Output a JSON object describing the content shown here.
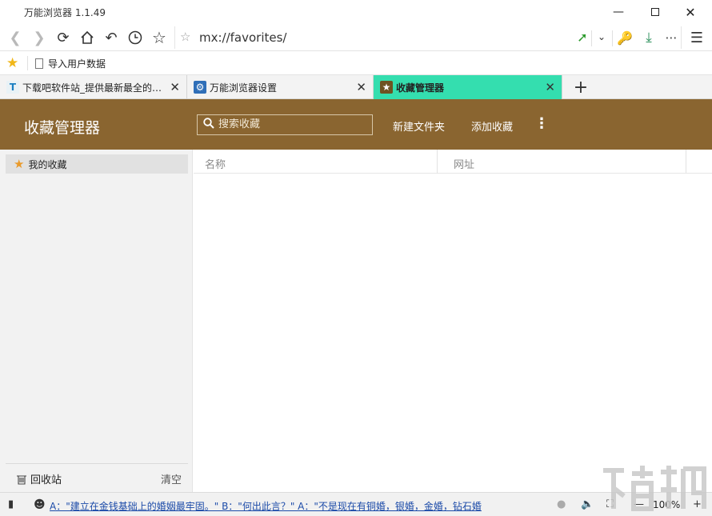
{
  "window": {
    "title": "万能浏览器 1.1.49",
    "minimize_icon": "minimize-icon",
    "maximize_icon": "maximize-icon",
    "close_icon": "close-icon"
  },
  "toolbar": {
    "address": "mx://favorites/",
    "icons": [
      "back-icon",
      "forward-icon",
      "refresh-icon",
      "home-icon",
      "undo-icon",
      "history-icon",
      "bookmark-star-icon",
      "address-star-icon",
      "pin-icon",
      "chevron-down-icon",
      "key-icon",
      "download-icon",
      "more-icon",
      "menu-icon"
    ]
  },
  "bookmarks_bar": {
    "item_label": "导入用户数据"
  },
  "tabs": [
    {
      "label": "下载吧软件站_提供最新最全的…",
      "icon": "tab-site-icon",
      "active": false
    },
    {
      "label": "万能浏览器设置",
      "icon": "settings-gear-icon",
      "active": false
    },
    {
      "label": "收藏管理器",
      "icon": "favorites-star-icon",
      "active": true
    }
  ],
  "header": {
    "title": "收藏管理器",
    "search_placeholder": "搜索收藏",
    "new_folder": "新建文件夹",
    "add_favorite": "添加收藏",
    "more": "⋮"
  },
  "sidebar": {
    "items": [
      {
        "label": "我的收藏",
        "icon": "star-icon"
      }
    ],
    "trash_label": "回收站",
    "clear_label": "清空"
  },
  "table": {
    "columns": [
      "名称",
      "网址"
    ],
    "rows": []
  },
  "statusbar": {
    "news": "A：\"建立在金钱基础上的婚姻最牢固。\" B：\"何出此言？\" A：\"不是现在有铜婚，银婚，金婚，钻石婚",
    "zoom": "100%"
  },
  "colors": {
    "header_bg": "#8a6530",
    "active_tab": "#34deaf",
    "sidebar_bg": "#f2f2f2",
    "bookmark_star": "#f1b719"
  }
}
